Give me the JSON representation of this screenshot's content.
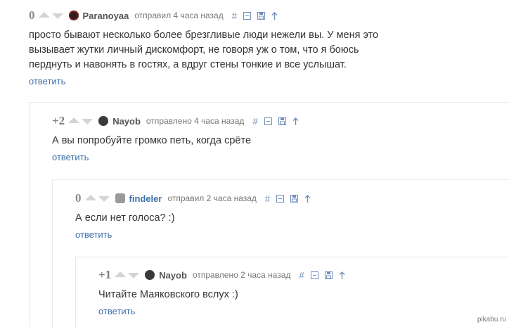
{
  "reply_label": "ответить",
  "comments": [
    {
      "rating": "0",
      "author": "Paranoyaa",
      "meta": "отправил 4 часа назад",
      "lines": [
        "просто бывают несколько более брезгливые люди нежели вы. У меня это",
        "вызывает жутки личный дискомфорт, не говоря уж о том, что я боюсь",
        "перднуть и навонять в гостях, а вдруг стены тонкие и все услышат."
      ]
    },
    {
      "rating": "+2",
      "author": "Nayob",
      "meta": "отправлено 4 часа назад",
      "lines": [
        "А вы попробуйте громко петь, когда срёте"
      ]
    },
    {
      "rating": "0",
      "author": "findeler",
      "meta": "отправил 2 часа назад",
      "lines": [
        "А если нет голоса? :)"
      ]
    },
    {
      "rating": "+1",
      "author": "Nayob",
      "meta": "отправлено 2 часа назад",
      "lines": [
        "Читайте Маяковского вслух :)"
      ]
    }
  ],
  "tools": {
    "hash": "#"
  },
  "watermark": "pikabu.ru",
  "colors": {
    "link": "#3a6fa8",
    "tool": "#6f8fb8",
    "vote": "#d4d4d4"
  },
  "icons": [
    "vote-up-icon",
    "vote-down-icon",
    "collapse-icon",
    "save-icon",
    "arrow-up-icon"
  ]
}
